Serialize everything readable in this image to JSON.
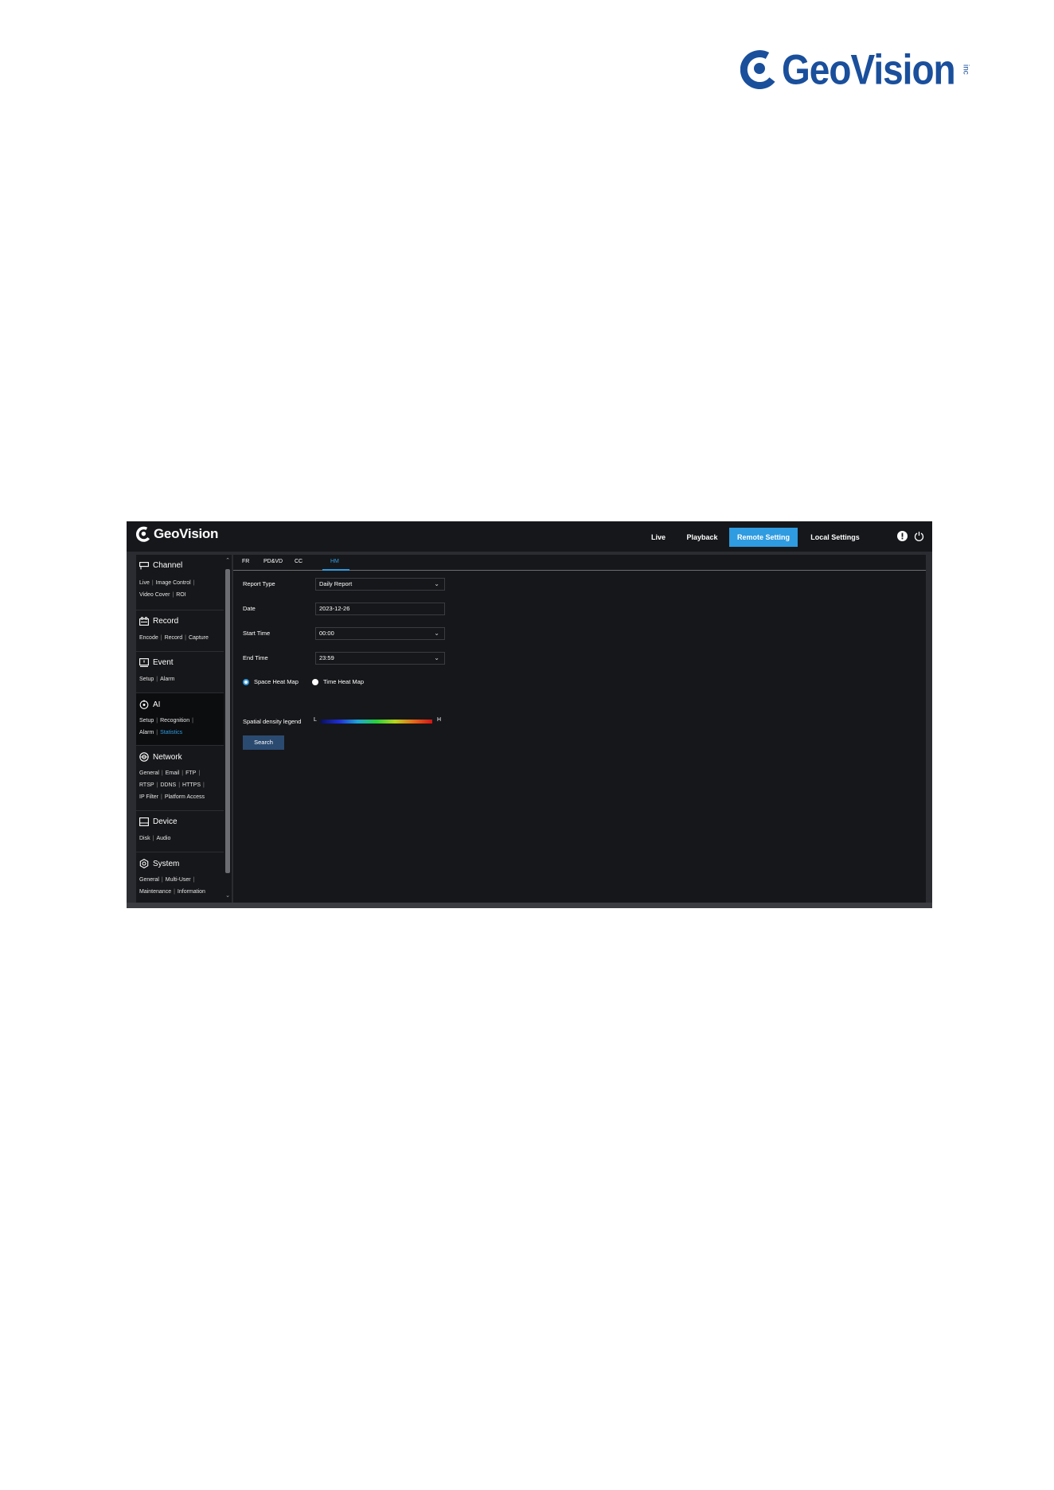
{
  "doc_logo": {
    "word": "GeoVision",
    "suffix": "inc"
  },
  "app": {
    "logo": "GeoVision",
    "nav": [
      {
        "label": "Live"
      },
      {
        "label": "Playback"
      },
      {
        "label": "Remote Setting"
      },
      {
        "label": "Local Settings"
      }
    ],
    "active_nav": "Remote Setting",
    "icons": [
      "info-icon",
      "power-icon"
    ]
  },
  "sidebar": {
    "channel": {
      "title": "Channel",
      "links": [
        "Live",
        "Image Control",
        "Video Cover",
        "ROI"
      ]
    },
    "record": {
      "title": "Record",
      "links": [
        "Encode",
        "Record",
        "Capture"
      ]
    },
    "event": {
      "title": "Event",
      "links": [
        "Setup",
        "Alarm"
      ]
    },
    "ai": {
      "title": "AI",
      "links": [
        "Setup",
        "Recognition",
        "Alarm",
        "Statistics"
      ],
      "active_link": "Statistics"
    },
    "network": {
      "title": "Network",
      "links": [
        "General",
        "Email",
        "FTP",
        "RTSP",
        "DDNS",
        "HTTPS",
        "IP Filter",
        "Platform Access"
      ]
    },
    "device": {
      "title": "Device",
      "links": [
        "Disk",
        "Audio"
      ]
    },
    "system": {
      "title": "System",
      "links": [
        "General",
        "Multi-User",
        "Maintenance",
        "Information"
      ]
    }
  },
  "tabs": [
    {
      "label": "FR"
    },
    {
      "label": "PD&VD"
    },
    {
      "label": "CC"
    },
    {
      "label": "HM"
    }
  ],
  "active_tab": "HM",
  "form": {
    "report_type": {
      "label": "Report Type",
      "value": "Daily Report"
    },
    "date": {
      "label": "Date",
      "value": "2023-12-26"
    },
    "start_time": {
      "label": "Start Time",
      "value": "00:00"
    },
    "end_time": {
      "label": "End Time",
      "value": "23:59"
    },
    "space_heat_map": {
      "label": "Space Heat Map",
      "selected": true
    },
    "time_heat_map": {
      "label": "Time Heat Map",
      "selected": false
    },
    "legend": {
      "label": "Spatial density legend",
      "low": "L",
      "high": "H"
    },
    "search_label": "Search"
  },
  "colors": {
    "accent": "#2f9be0",
    "brand": "#1a4f9c",
    "button": "#2b4a70",
    "panel": "#16171a"
  }
}
